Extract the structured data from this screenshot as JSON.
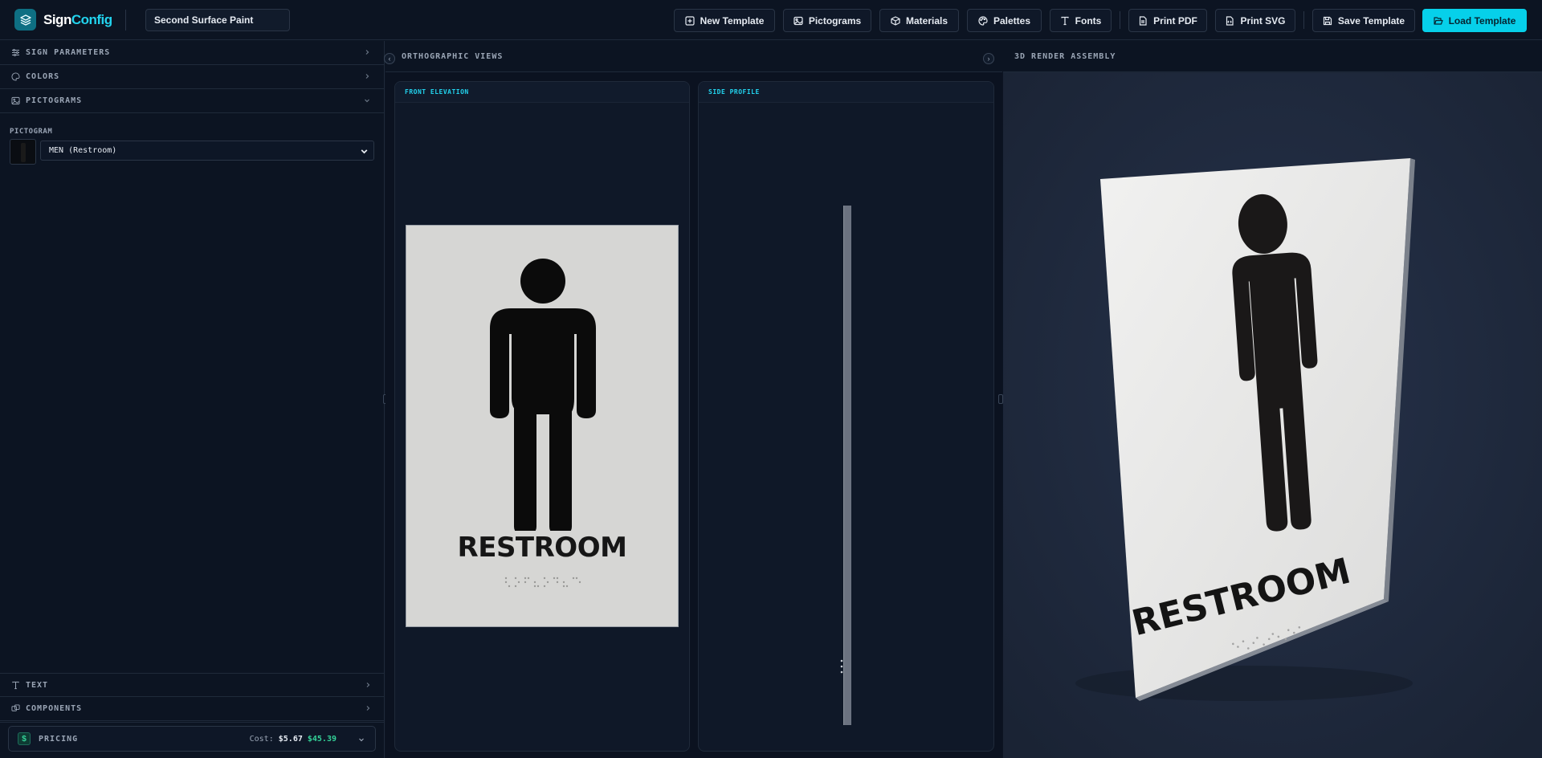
{
  "app": {
    "brand_first": "Sign",
    "brand_second": "Config",
    "template_name": "Second Surface Paint"
  },
  "toolbar": {
    "new_template": "New Template",
    "pictograms": "Pictograms",
    "materials": "Materials",
    "palettes": "Palettes",
    "fonts": "Fonts",
    "print_pdf": "Print PDF",
    "print_svg": "Print SVG",
    "save_template": "Save Template",
    "load_template": "Load Template"
  },
  "sidebar": {
    "sections": [
      {
        "label": "SIGN PARAMETERS",
        "icon": "sliders-icon",
        "expanded": false
      },
      {
        "label": "COLORS",
        "icon": "palette-icon",
        "expanded": false
      },
      {
        "label": "PICTOGRAMS",
        "icon": "image-icon",
        "expanded": true
      }
    ],
    "pictogram_field_label": "PICTOGRAM",
    "pictogram_selected": "MEN (Restroom)",
    "bottom_sections": [
      {
        "label": "TEXT",
        "icon": "type-icon"
      },
      {
        "label": "COMPONENTS",
        "icon": "component-icon"
      }
    ],
    "pricing": {
      "label": "PRICING",
      "cost_label": "Cost:",
      "cost": "$5.67",
      "price": "$45.39"
    }
  },
  "ortho": {
    "title": "ORTHOGRAPHIC VIEWS",
    "front_label": "FRONT ELEVATION",
    "side_label": "SIDE PROFILE",
    "sign_text": "RESTROOM"
  },
  "render": {
    "title": "3D RENDER ASSEMBLY",
    "sign_text": "RESTROOM"
  },
  "colors": {
    "accent": "#06d0ea",
    "price_green": "#34d399",
    "panel_bg": "#0c1422",
    "plate": "#d6d6d4",
    "pictogram": "#161616"
  }
}
